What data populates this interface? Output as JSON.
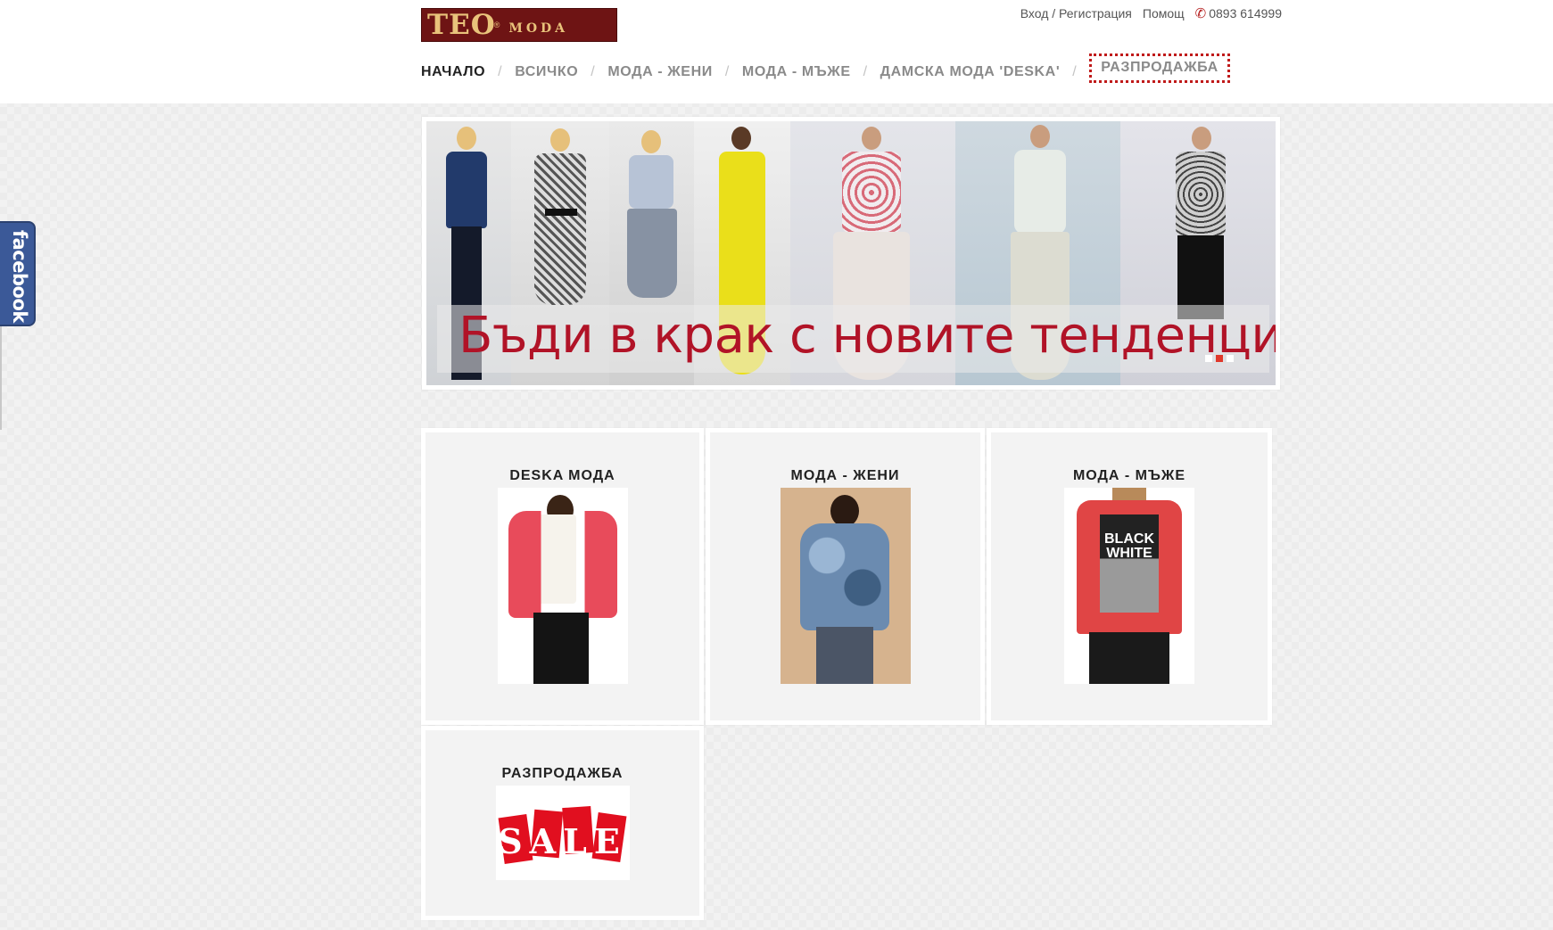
{
  "header": {
    "logo": {
      "main": "TEO",
      "sub": "MODA"
    },
    "top_links": {
      "login": "Вход / Регистрация",
      "help": "Помощ",
      "phone": "0893 614999"
    },
    "nav": [
      {
        "label": "НАЧАЛО",
        "active": true
      },
      {
        "label": "ВСИЧКО"
      },
      {
        "label": "МОДА - ЖЕНИ"
      },
      {
        "label": "МОДА - МЪЖЕ"
      },
      {
        "label": "ДАМСКА МОДА 'DESKA'"
      },
      {
        "label": "РАЗПРОДАЖБА",
        "highlight": "#c01a1a"
      }
    ],
    "separator": "/"
  },
  "banner": {
    "tagline": "Бъди в крак с новите тенденци",
    "slides": 3,
    "active_slide": 2
  },
  "categories": [
    {
      "title": "DESKA МОДА",
      "image": "red-blazer-woman"
    },
    {
      "title": "МОДА - ЖЕНИ",
      "image": "camo-bomber-jacket-woman"
    },
    {
      "title": "МОДА - МЪЖЕ",
      "image": "red-tshirt-black-white-print"
    },
    {
      "title": "РАЗПРОДАЖБА",
      "image": "sale-tags"
    }
  ],
  "sale_image_text": "SALE",
  "tshirt_print": {
    "line1": "BLACK",
    "line2": "WHITE"
  },
  "social": {
    "facebook": "facebook"
  },
  "colors": {
    "accent": "#b11327",
    "facebook": "#3b5998",
    "logo_bg": "#6e1414",
    "logo_text": "#e9c37b"
  }
}
